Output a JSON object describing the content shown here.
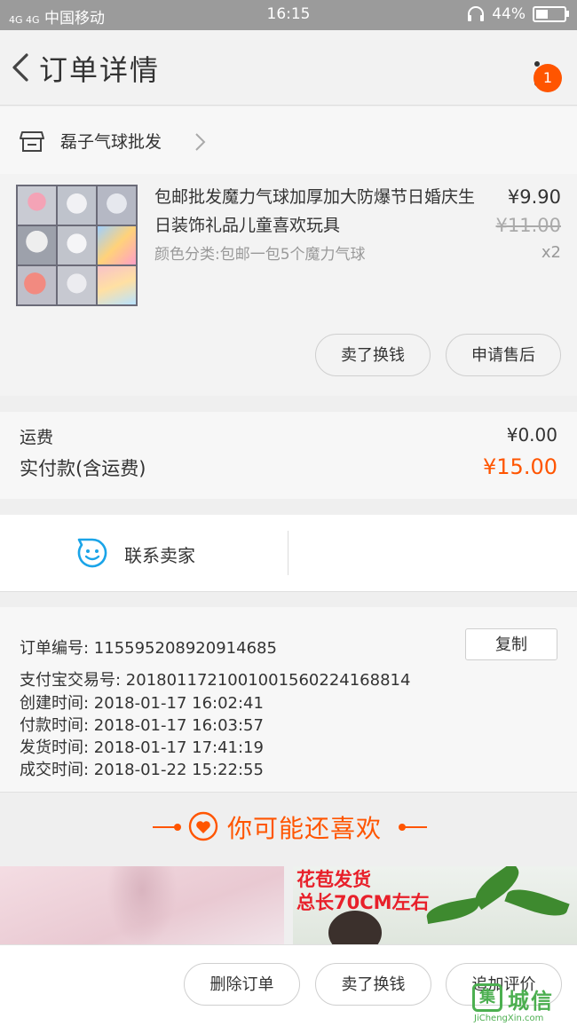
{
  "status_bar": {
    "network": "4G 4G",
    "carrier": "中国移动",
    "time": "16:15",
    "battery": "44%",
    "battery_level": 0.44
  },
  "header": {
    "title": "订单详情",
    "notification_count": "1"
  },
  "shop": {
    "name": "磊子气球批发"
  },
  "product": {
    "title": "包邮批发魔力气球加厚加大防爆节日婚庆生日装饰礼品儿童喜欢玩具",
    "sku": "颜色分类:包邮一包5个魔力气球",
    "price": "¥9.90",
    "original_price": "¥11.00",
    "quantity": "x2",
    "buttons": [
      "卖了换钱",
      "申请售后"
    ]
  },
  "fees": {
    "shipping_label": "运费",
    "shipping_value": "¥0.00",
    "paid_label": "实付款(含运费)",
    "paid_value": "¥15.00"
  },
  "contact": {
    "label": "联系卖家"
  },
  "order_info": {
    "order_no": "订单编号:  1155952089209146​85",
    "alipay_no": "支付宝交易号:  2018011721001001560224168814",
    "created": "创建时间:  2018-01-17  16:02:41",
    "paid": "付款时间:  2018-01-17  16:03:57",
    "shipped": "发货时间:  2018-01-17  17:41:19",
    "completed": "成交时间:  2018-01-22  15:22:55",
    "copy_label": "复制"
  },
  "recommend": {
    "title": "你可能还喜欢",
    "card2_text_line1": "花苞发货",
    "card2_text_line2": "总长70CM左右"
  },
  "bottom_bar": {
    "delete": "删除订单",
    "sell": "卖了换钱",
    "review": "追加评价"
  },
  "watermark": {
    "name": "城信",
    "url": "JiChengXin.com"
  },
  "colors": {
    "accent": "#ff5500",
    "status_bar": "#9b9b9b",
    "link_blue": "#1aa4e8",
    "watermark_green": "#4caf50"
  }
}
